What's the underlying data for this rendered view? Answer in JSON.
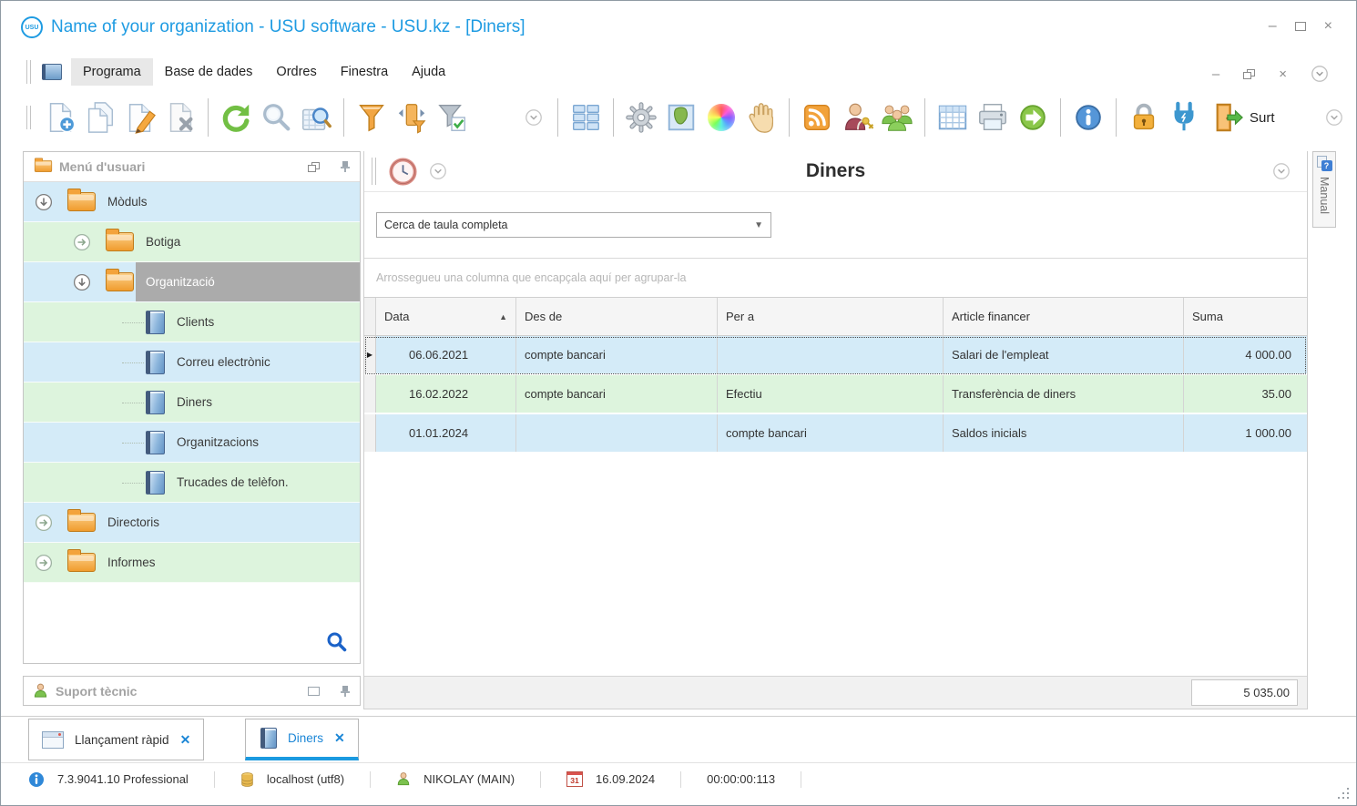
{
  "window": {
    "title": "Name of your organization - USU software - USU.kz - [Diners]",
    "logo_text": "USU"
  },
  "menu": {
    "items": [
      "Programa",
      "Base de dades",
      "Ordres",
      "Finestra",
      "Ajuda"
    ],
    "active_item": "Programa"
  },
  "toolbar": {
    "exit_label": "Surt"
  },
  "sidebar": {
    "menu_panel_title": "Menú d'usuari",
    "support_panel_title": "Suport tècnic",
    "tree": [
      {
        "label": "Mòduls",
        "level": 0,
        "icon": "folder",
        "expand": "down",
        "bg": "blue"
      },
      {
        "label": "Botiga",
        "level": 1,
        "icon": "folder",
        "expand": "right",
        "bg": "green"
      },
      {
        "label": "Organització",
        "level": 1,
        "icon": "folder",
        "expand": "down",
        "bg": "blue",
        "selected": true
      },
      {
        "label": "Clients",
        "level": 2,
        "icon": "book",
        "bg": "green"
      },
      {
        "label": "Correu electrònic",
        "level": 2,
        "icon": "book",
        "bg": "blue"
      },
      {
        "label": "Diners",
        "level": 2,
        "icon": "book",
        "bg": "green"
      },
      {
        "label": "Organitzacions",
        "level": 2,
        "icon": "book",
        "bg": "blue"
      },
      {
        "label": "Trucades de telèfon.",
        "level": 2,
        "icon": "book",
        "bg": "green"
      },
      {
        "label": "Directoris",
        "level": 0,
        "icon": "folder",
        "expand": "right",
        "bg": "blue"
      },
      {
        "label": "Informes",
        "level": 0,
        "icon": "folder",
        "expand": "right",
        "bg": "green"
      }
    ]
  },
  "main": {
    "title": "Diners",
    "search_value": "Cerca de taula completa",
    "group_hint": "Arrossegueu una columna que encapçala aquí per agrupar-la",
    "manual_tab_label": "Manual",
    "table": {
      "columns": [
        {
          "label": "Data",
          "sort": "asc"
        },
        {
          "label": "Des de"
        },
        {
          "label": "Per a"
        },
        {
          "label": "Article financer"
        },
        {
          "label": "Suma"
        }
      ],
      "rows": [
        {
          "cells": [
            "06.06.2021",
            "compte bancari",
            "",
            "Salari de l'empleat",
            "4 000.00"
          ],
          "bg": "blue",
          "selected": true
        },
        {
          "cells": [
            "16.02.2022",
            "compte bancari",
            "Efectiu",
            "Transferència de diners",
            "35.00"
          ],
          "bg": "green"
        },
        {
          "cells": [
            "01.01.2024",
            "",
            "compte bancari",
            "Saldos inicials",
            "1 000.00"
          ],
          "bg": "blue"
        }
      ],
      "total": "5 035.00"
    }
  },
  "tabs": [
    {
      "label": "Llançament ràpid",
      "icon": "window"
    },
    {
      "label": "Diners",
      "icon": "book",
      "active": true
    }
  ],
  "statusbar": {
    "version": "7.3.9041.10 Professional",
    "database": "localhost (utf8)",
    "user": "NIKOLAY (MAIN)",
    "calendar_day": "31",
    "date": "16.09.2024",
    "timer": "00:00:00:113"
  },
  "colors": {
    "accent_blue": "#1b9be0",
    "row_blue": "#d4ebf8",
    "row_green": "#ddf4dd",
    "selected_gray": "#ababab",
    "filter_orange": "#f2a643",
    "go_green": "#8bc74a"
  }
}
